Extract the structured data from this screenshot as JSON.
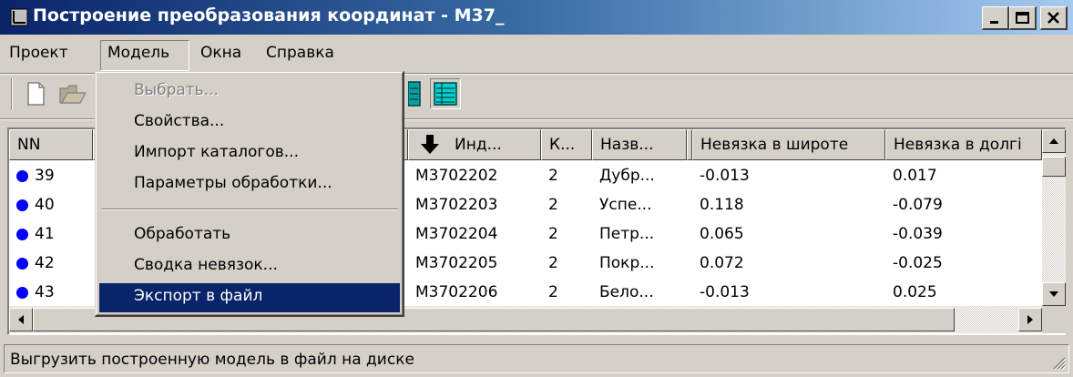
{
  "window": {
    "title": "Построение преобразования координат - M37_",
    "controls": [
      "minimize-icon",
      "maximize-icon",
      "close-icon"
    ]
  },
  "menubar": {
    "items": [
      "Проект",
      "Модель",
      "Окна",
      "Справка"
    ],
    "active": "Модель"
  },
  "dropdown": {
    "items": [
      {
        "label": "Выбрать...",
        "state": "disabled"
      },
      {
        "label": "Свойства...",
        "state": "normal"
      },
      {
        "label": "Импорт каталогов...",
        "state": "normal"
      },
      {
        "label": "Параметры обработки...",
        "state": "normal"
      },
      {
        "label": "Обработать",
        "state": "normal"
      },
      {
        "label": "Сводка невязок...",
        "state": "normal"
      },
      {
        "label": "Экспорт в файл",
        "state": "selected"
      }
    ]
  },
  "grid": {
    "headers": [
      "NN",
      "Инд...",
      "К...",
      "Назв...",
      "Невязка в широте",
      "Невязка в долгі"
    ],
    "sort_column": "Инд...",
    "rows": [
      {
        "nn": "39",
        "index": "M3702202",
        "k": "2",
        "name": "Дубр...",
        "dlat": "-0.013",
        "dlon": "0.017"
      },
      {
        "nn": "40",
        "index": "M3702203",
        "k": "2",
        "name": "Успе...",
        "dlat": "0.118",
        "dlon": "-0.079"
      },
      {
        "nn": "41",
        "index": "M3702204",
        "k": "2",
        "name": "Петр...",
        "dlat": "0.065",
        "dlon": "-0.039"
      },
      {
        "nn": "42",
        "index": "M3702205",
        "k": "2",
        "name": "Покр...",
        "dlat": "0.072",
        "dlon": "-0.025"
      },
      {
        "nn": "43",
        "index": "M3702206",
        "k": "2",
        "name": "Бело...",
        "dlat": "-0.013",
        "dlon": "0.025"
      }
    ]
  },
  "statusbar": {
    "text": "Выгрузить построенную модель в файл на диске"
  },
  "colors": {
    "title_start": "#0a246a",
    "title_end": "#a6caf0",
    "selection": "#0a246a",
    "row_dot": "#0000ff",
    "face": "#d4d0c8"
  }
}
